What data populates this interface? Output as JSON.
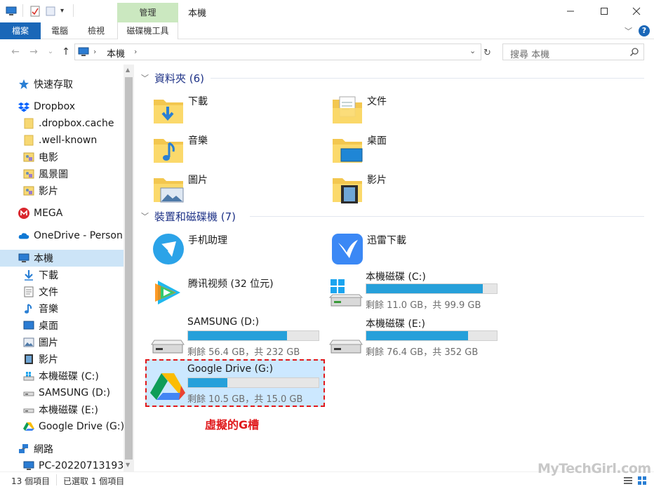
{
  "window": {
    "title": "本機",
    "context_tab_group": "管理",
    "ribbon_tabs": [
      "檔案",
      "電腦",
      "檢視",
      "磁碟機工具"
    ]
  },
  "address": {
    "path": "本機",
    "search_placeholder": "搜尋 本機"
  },
  "nav": {
    "quick_access": "快速存取",
    "dropbox": "Dropbox",
    "dropbox_children": [
      ".dropbox.cache",
      ".well-known",
      "电影",
      "風景圖",
      "影片"
    ],
    "mega": "MEGA",
    "onedrive": "OneDrive - Person",
    "this_pc": "本機",
    "this_pc_children": [
      "下載",
      "文件",
      "音樂",
      "桌面",
      "圖片",
      "影片",
      "本機磁碟 (C:)",
      "SAMSUNG (D:)",
      "本機磁碟 (E:)",
      "Google Drive (G:)"
    ],
    "network": "網路",
    "network_children": [
      "PC-20220713193"
    ]
  },
  "folders": {
    "header": "資料夾 (6)",
    "items": [
      "下載",
      "文件",
      "音樂",
      "桌面",
      "圖片",
      "影片"
    ]
  },
  "devices": {
    "header": "裝置和磁碟機 (7)",
    "apps": [
      "手机助理",
      "迅雷下載",
      "腾讯视频 (32 位元)"
    ],
    "drives": [
      {
        "label": "本機磁碟 (C:)",
        "free": "剩餘 11.0 GB，共 99.9 GB",
        "used_pct": 89
      },
      {
        "label": "SAMSUNG (D:)",
        "free": "剩餘 56.4 GB，共 232 GB",
        "used_pct": 76
      },
      {
        "label": "本機磁碟 (E:)",
        "free": "剩餘 76.4 GB，共 352 GB",
        "used_pct": 78
      },
      {
        "label": "Google Drive (G:)",
        "free": "剩餘 10.5 GB，共 15.0 GB",
        "used_pct": 30
      }
    ]
  },
  "annotation": "虛擬的G槽",
  "status": {
    "item_count": "13 個項目",
    "selected": "已選取 1 個項目"
  },
  "watermark": "MyTechGirl.com",
  "colors": {
    "accent": "#1a67b8",
    "bar_fill": "#26a0da",
    "selection": "#cce8ff",
    "annotation": "#e0191c",
    "group_header": "#1e3287"
  }
}
